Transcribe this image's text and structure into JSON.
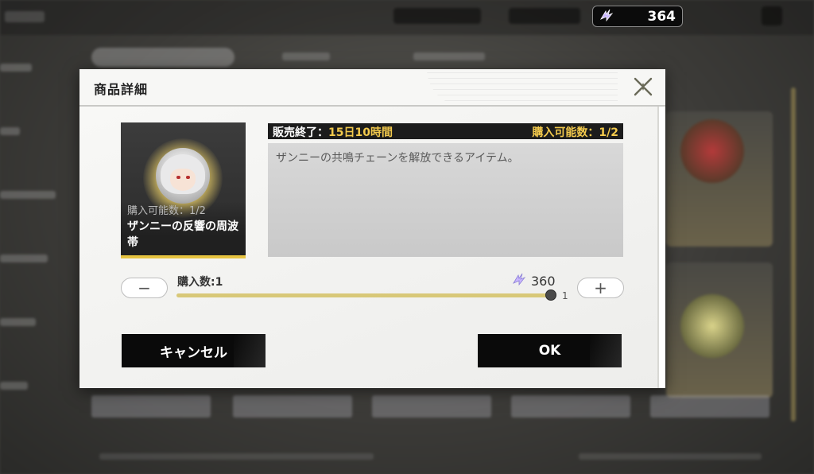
{
  "currency": {
    "icon": "lunite-icon",
    "amount": "364"
  },
  "dialog": {
    "title": "商品詳細",
    "item": {
      "purchase_limit_overlay": "購入可能数：1/2",
      "name": "ザンニーの反響の周波帯"
    },
    "sale_end_label": "販売終了：",
    "sale_end_value": "15日10時間",
    "purchase_limit": "購入可能数：1/2",
    "description": "ザンニーの共鳴チェーンを解放できるアイテム。",
    "quantity_label": "購入数:1",
    "price": "360",
    "slider": {
      "value": 1,
      "max": 1,
      "max_label": "1"
    },
    "minus_label": "−",
    "plus_label": "+",
    "cancel_label": "キャンセル",
    "ok_label": "OK"
  },
  "colors": {
    "accent_gold": "#f2c94c",
    "button_dark": "#0a0a0a",
    "slider_track": "#d8c878"
  }
}
